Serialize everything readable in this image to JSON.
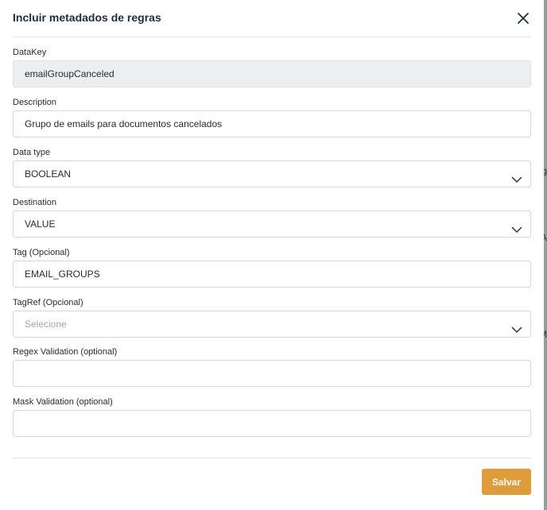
{
  "modal": {
    "title": "Incluir metadados de regras",
    "close_icon": "close-icon"
  },
  "fields": {
    "datakey": {
      "label": "DataKey",
      "value": "emailGroupCanceled"
    },
    "description": {
      "label": "Description",
      "value": "Grupo de emails para documentos cancelados"
    },
    "data_type": {
      "label": "Data type",
      "value": "BOOLEAN"
    },
    "destination": {
      "label": "Destination",
      "value": "VALUE"
    },
    "tag": {
      "label": "Tag (Opcional)",
      "value": "EMAIL_GROUPS"
    },
    "tagref": {
      "label": "TagRef (Opcional)",
      "placeholder": "Selecione"
    },
    "regex": {
      "label": "Regex Validation (optional)",
      "value": ""
    },
    "mask": {
      "label": "Mask Validation (optional)",
      "value": ""
    }
  },
  "footer": {
    "save_label": "Salvar"
  },
  "background_peek": {
    "a": "ig",
    "b": "A",
    "c": "n",
    "d": "M"
  },
  "colors": {
    "accent": "#df9c3a",
    "title": "#1f2d3d",
    "disabled_bg": "#eceeef"
  }
}
